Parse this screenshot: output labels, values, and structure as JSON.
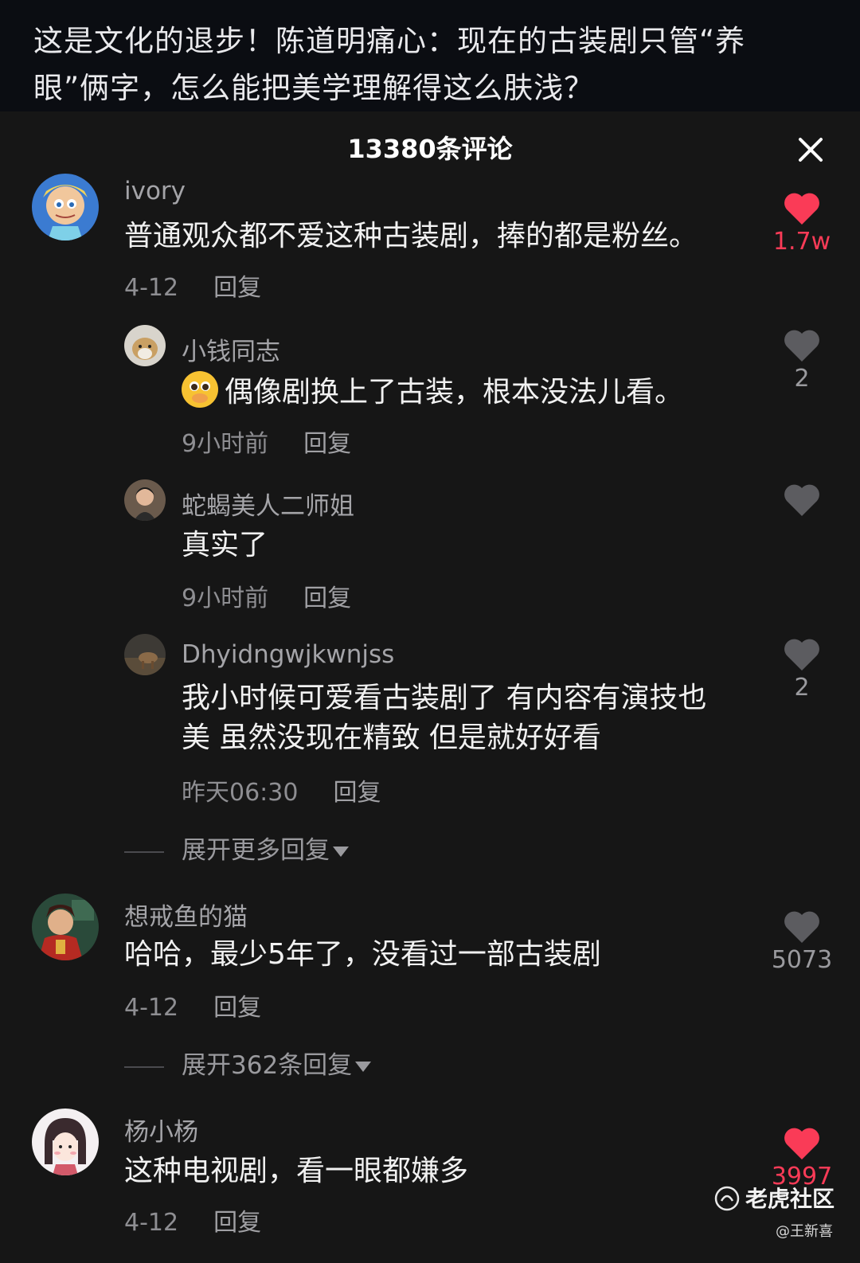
{
  "headline": {
    "line1": "这是文化的退步！陈道明痛心：现在的古装剧只管“养",
    "line2": "眼”俩字，怎么能把美学理解得这么肤浅？"
  },
  "sheet": {
    "title": "13380条评论",
    "close_icon": "close-icon"
  },
  "comments": [
    {
      "user": "ivory",
      "text": "普通观众都不爱这种古装剧，捧的都是粉丝。",
      "date": "4-12",
      "reply": "回复",
      "likes": "1.7w",
      "liked": true
    },
    {
      "user": "小钱同志",
      "text": "偶像剧换上了古装，根本没法儿看。",
      "date": "9小时前",
      "reply": "回复",
      "likes": "2",
      "liked": false
    },
    {
      "user": "蛇蝎美人二师姐",
      "text": "真实了",
      "date": "9小时前",
      "reply": "回复",
      "likes": "",
      "liked": false
    },
    {
      "user": "Dhyidngwjkwnjss",
      "text_line1": "我小时候可爱看古装剧了 有内容有演技也",
      "text_line2": "美 虽然没现在精致 但是就好好看",
      "date": "昨天06:30",
      "reply": "回复",
      "likes": "2",
      "liked": false
    },
    {
      "user": "想戒鱼的猫",
      "text": "哈哈，最少5年了，没看过一部古装剧",
      "date": "4-12",
      "reply": "回复",
      "likes": "5073",
      "liked": false
    },
    {
      "user": "杨小杨",
      "text": "这种电视剧，看一眼都嫌多",
      "date": "4-12",
      "reply": "回复",
      "likes": "3997",
      "liked": true
    }
  ],
  "expand": {
    "more": "展开更多回复",
    "count": "展开362条回复"
  },
  "watermark": {
    "brand": "老虎社区",
    "author": "@王新喜"
  },
  "colors": {
    "like_red": "#fa3b57",
    "like_gray": "#5c5c60",
    "background": "#161616"
  }
}
